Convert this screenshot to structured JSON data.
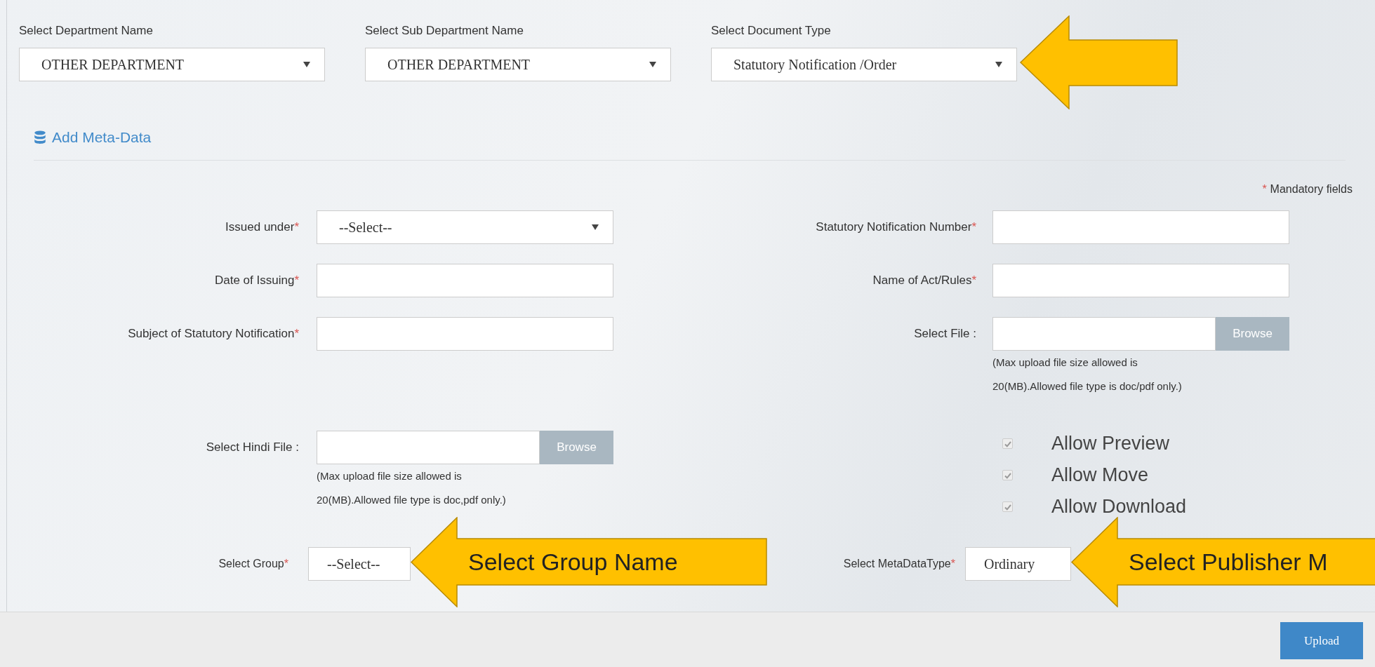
{
  "top_selects": [
    {
      "label": "Select Department Name",
      "value": "OTHER DEPARTMENT"
    },
    {
      "label": "Select Sub Department Name",
      "value": "OTHER DEPARTMENT"
    },
    {
      "label": "Select Document Type",
      "value": "Statutory Notification /Order"
    }
  ],
  "section": {
    "title": "Add Meta-Data"
  },
  "mandatory_note": {
    "mark": "*",
    "text": "Mandatory fields"
  },
  "rows": [
    {
      "left": {
        "kind": "select",
        "label": "Issued under",
        "mark": "*",
        "value": "--Select--"
      },
      "right": {
        "kind": "text",
        "label": "Statutory Notification Number",
        "mark": "*"
      }
    },
    {
      "left": {
        "kind": "text",
        "label": "Date of Issuing",
        "mark": "*"
      },
      "right": {
        "kind": "text",
        "label": "Name of Act/Rules",
        "mark": "*"
      }
    },
    {
      "left": {
        "kind": "text",
        "label": "Subject of Statutory Notification",
        "mark": "*"
      },
      "right": {
        "kind": "file",
        "label": "Select File :",
        "button": "Browse",
        "note": [
          "(Max upload file size allowed is",
          "20(MB).Allowed file type is doc/pdf only.)"
        ]
      }
    }
  ],
  "hindi_file": {
    "label": "Select Hindi File :",
    "button": "Browse",
    "note": [
      "(Max upload file size allowed is",
      "20(MB).Allowed file type is doc,pdf only.)"
    ]
  },
  "permissions": [
    {
      "label": "Allow Preview",
      "checked": true,
      "disabled": true
    },
    {
      "label": "Allow Move",
      "checked": true,
      "disabled": true
    },
    {
      "label": "Allow Download",
      "checked": true,
      "disabled": true
    }
  ],
  "group": {
    "label": "Select Group",
    "mark": "*",
    "value": "--Select--"
  },
  "metadata_type": {
    "label": "Select MetaDataType",
    "mark": "*",
    "value": "Ordinary"
  },
  "footer": {
    "button": "Upload"
  },
  "callouts": [
    {
      "kind": "arrow"
    },
    {
      "kind": "labeled-arrow",
      "text": "Select Group Name"
    },
    {
      "kind": "labeled-arrow",
      "text": "Select Publisher M"
    }
  ]
}
